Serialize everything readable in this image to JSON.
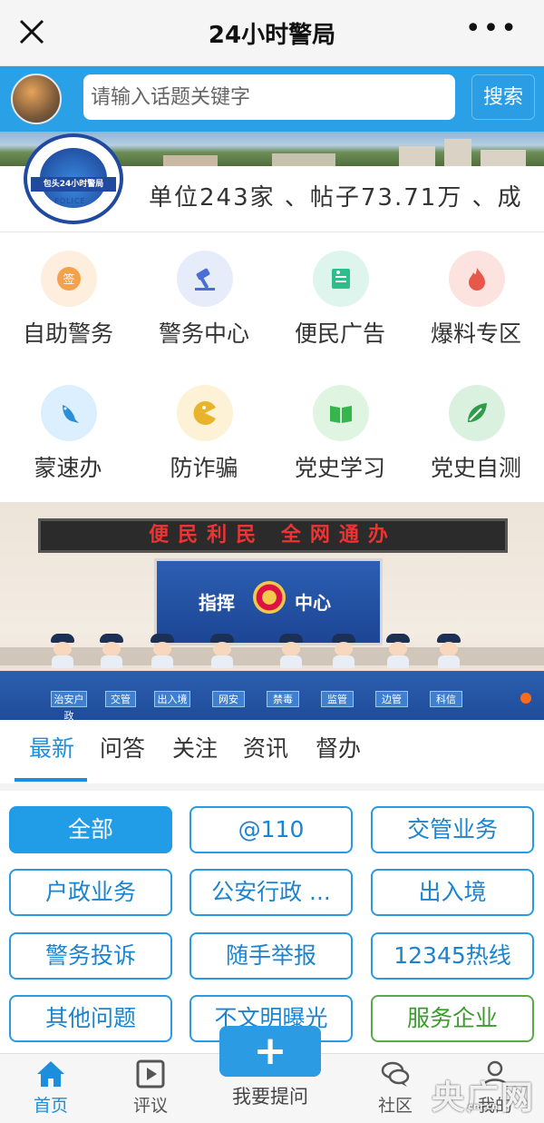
{
  "window": {
    "title": "24小时警局",
    "more": "•••"
  },
  "search": {
    "placeholder": "请输入话题关键字",
    "button": "搜索"
  },
  "banner": {
    "logo_text": "包头24小时警局",
    "logo_sub": "POLICE",
    "stats": "单位243家 、帖子73.71万 、成"
  },
  "services": [
    {
      "label": "自助警务",
      "icon": "sign-badge-icon",
      "color": "#f5a04a"
    },
    {
      "label": "警务中心",
      "icon": "gavel-icon",
      "color": "#4a6fd4"
    },
    {
      "label": "便民广告",
      "icon": "notice-board-icon",
      "color": "#2dbf8a"
    },
    {
      "label": "爆料专区",
      "icon": "flame-icon",
      "color": "#e8584a"
    },
    {
      "label": "蒙速办",
      "icon": "bird-icon",
      "color": "#2a8fd8"
    },
    {
      "label": "防诈骗",
      "icon": "pacman-icon",
      "color": "#e9b42c"
    },
    {
      "label": "党史学习",
      "icon": "book-icon",
      "color": "#35b64c"
    },
    {
      "label": "党史自测",
      "icon": "leaf-icon",
      "color": "#2f9c4a"
    }
  ],
  "hero": {
    "led_text": "便民利民 全网通办",
    "screen_left": "指挥",
    "screen_right": "中心",
    "desk_tags": [
      "治安户政",
      "交管",
      "出入境",
      "网安",
      "禁毒",
      "监管",
      "边管",
      "科信"
    ]
  },
  "tabs": [
    "最新",
    "问答",
    "关注",
    "资讯",
    "督办"
  ],
  "categories": [
    "全部",
    "@110",
    "交管业务",
    "户政业务",
    "公安行政 ...",
    "出入境",
    "警务投诉",
    "随手举报",
    "12345热线",
    "其他问题",
    "不文明曝光",
    "服务企业"
  ],
  "bottom_nav": {
    "home": "首页",
    "review": "评议",
    "ask": "我要提问",
    "community": "社区",
    "mine": "我的"
  },
  "watermark": {
    "text": "央广网",
    "sub": "cnr.cn"
  }
}
